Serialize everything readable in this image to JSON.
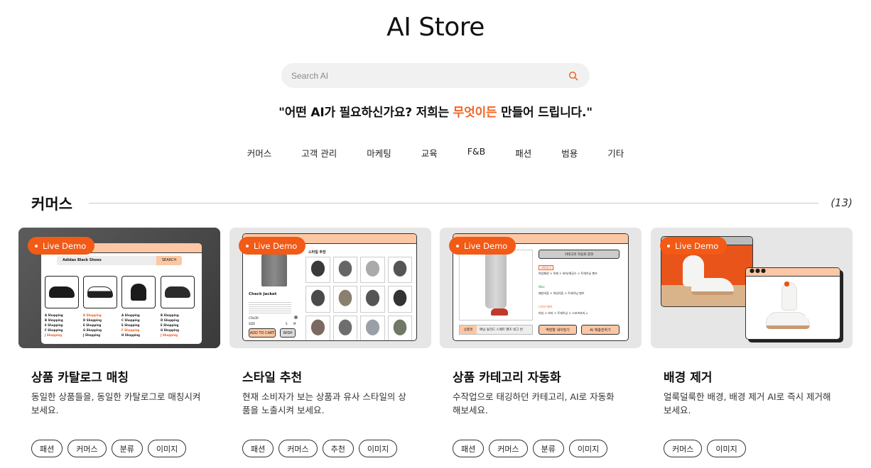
{
  "page_title": "AI Store",
  "search": {
    "placeholder": "Search AI"
  },
  "tagline": {
    "prefix": "\"어떤 AI가 필요하신가요? 저희는 ",
    "highlight": "무엇이든",
    "suffix": " 만들어 드립니다.\""
  },
  "categories": [
    "커머스",
    "고객 관리",
    "마케팅",
    "교육",
    "F&B",
    "패션",
    "범용",
    "기타"
  ],
  "section": {
    "title": "커머스",
    "count": "(13)"
  },
  "live_demo_label": "Live Demo",
  "cards": [
    {
      "title": "상품 카탈로그 매칭",
      "desc": "동일한 상품들을, 동일한 카탈로그로 매칭시켜보세요.",
      "tags": [
        "패션",
        "커머스",
        "분류",
        "이미지"
      ]
    },
    {
      "title": "스타일 추천",
      "desc": "현재 소비자가 보는 상품과 유사 스타일의 상품을 노출시켜 보세요.",
      "tags": [
        "패션",
        "커머스",
        "추천",
        "이미지"
      ]
    },
    {
      "title": "상품 카테고리 자동화",
      "desc": "수작업으로 태깅하던 카테고리, AI로 자동화 해보세요.",
      "tags": [
        "패션",
        "커머스",
        "분류",
        "이미지"
      ]
    },
    {
      "title": "배경 제거",
      "desc": "얼룩덜룩한 배경, 배경 제거 AI로 즉시 제거해 보세요.",
      "tags": [
        "커머스",
        "이미지"
      ]
    }
  ],
  "mock1": {
    "query": "Adidas Black Shoes",
    "search_btn": "SEARCH",
    "columns": [
      [
        "A Shopping",
        "B Shopping",
        "E Shopping",
        "F Shopping",
        "J Shopping"
      ],
      [
        "B Shopping",
        "D Shopping",
        "E Shopping",
        "G Shopping",
        "J Shopping"
      ],
      [
        "A Shopping",
        "C Shopping",
        "E Shopping",
        "F Shopping",
        "H Shopping"
      ],
      [
        "B Shopping",
        "D Shopping",
        "E Shopping",
        "G Shopping",
        "J Shopping"
      ]
    ]
  },
  "mock2": {
    "header": "스타일 추천",
    "product": "Check Jacket",
    "color_label": "COLOR",
    "size_label": "SIZE",
    "size_s": "S",
    "size_m": "M",
    "cart_btn": "ADD TO CART",
    "wish_btn": "WISH"
  },
  "mock3": {
    "header_btn": "카테고리 자동화 결과",
    "brand_1": "UNIQLO",
    "path_1": "여성패션 > 하체 > 바지/레깅스 > 트레이닝 팬츠",
    "brand_2": "Nike",
    "path_2": "패션의류 > 여성의류 > 트레이닝 팬츠",
    "brand_3": "나이키 팬츠",
    "path_3": "여성 > 바지 > 트레이닝 > 스포츠바지 ▫",
    "field_label": "상품명",
    "field_value": "애님 솔리드 스웨트 팬츠 네그 반",
    "btn_1": "역방향 네이밍기",
    "btn_2": "AI 재충전하기"
  },
  "colors": {
    "accent": "#f25a16",
    "highlight": "#f26522",
    "mock_bar": "#fcc7a4"
  }
}
